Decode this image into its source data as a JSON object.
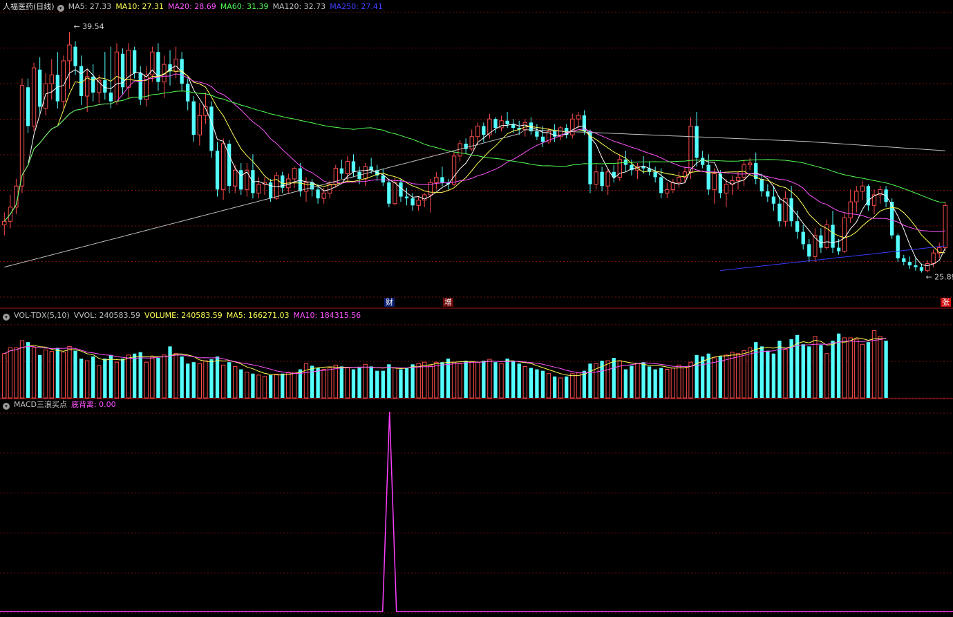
{
  "colors": {
    "up": "#ff4d4d",
    "down": "#54ffff",
    "ma5": "#ffffff",
    "ma10": "#ffff54",
    "ma20": "#ff54ff",
    "ma60": "#54ff54",
    "ma120": "#c0c0c0",
    "ma250": "#3a3aff",
    "grid": "#7a1010",
    "ma5_label": "#c0c0c0",
    "ma10_label": "#ffff54",
    "ma20_label": "#ff54ff",
    "ma60_label": "#54ff54",
    "ma120_label": "#c0c0c0",
    "ma250_label": "#4040ff",
    "macd_line": "#ff40ff"
  },
  "price_panel": {
    "title": "人福医药(日线)",
    "legend": [
      {
        "text": "MA5: 27.33",
        "color": "#c0c0c0"
      },
      {
        "text": "MA10: 27.31",
        "color": "#ffff54"
      },
      {
        "text": "MA20: 28.69",
        "color": "#ff54ff"
      },
      {
        "text": "MA60: 31.39",
        "color": "#54ff54"
      },
      {
        "text": "MA120: 32.73",
        "color": "#c0c0c0"
      },
      {
        "text": "MA250: 27.41",
        "color": "#4040ff"
      }
    ],
    "high_label": "39.54",
    "low_label": "25.89",
    "badges": [
      {
        "text": "财",
        "bg": "#0a1e6e",
        "fg": "#ffffff"
      },
      {
        "text": "增",
        "bg": "#6e0a0a",
        "fg": "#ffffff"
      },
      {
        "text": "张",
        "bg": "#d01010",
        "fg": "#ffffff"
      }
    ]
  },
  "vol_panel": {
    "label": "VOL-TDX(5,10)",
    "legend": [
      {
        "text": "VVOL: 240583.59",
        "color": "#c0c0c0"
      },
      {
        "text": "VOLUME: 240583.59",
        "color": "#ffff54"
      },
      {
        "text": "MA5: 166271.03",
        "color": "#ffff54"
      },
      {
        "text": "MA10: 184315.56",
        "color": "#ff54ff"
      }
    ]
  },
  "macd_panel": {
    "label": "MACD三浪买点",
    "legend": [
      {
        "text": "底背离: 0.00",
        "color": "#ff54ff"
      }
    ]
  },
  "chart_data": [
    {
      "type": "candlestick",
      "title": "人福医药(日线)",
      "ylim": [
        24.5,
        40.8
      ],
      "candles": [
        [
          28.6,
          29.3,
          28.0,
          28.8
        ],
        [
          28.8,
          30.3,
          28.4,
          29.6
        ],
        [
          29.6,
          31.2,
          29.2,
          30.8
        ],
        [
          30.8,
          36.9,
          30.4,
          36.5
        ],
        [
          36.4,
          36.9,
          33.8,
          34.2
        ],
        [
          34.2,
          37.8,
          33.9,
          37.5
        ],
        [
          37.4,
          38.1,
          34.9,
          35.3
        ],
        [
          35.2,
          37.2,
          34.8,
          36.6
        ],
        [
          36.6,
          38.0,
          35.7,
          37.1
        ],
        [
          37.1,
          38.4,
          35.2,
          35.6
        ],
        [
          35.6,
          38.2,
          35.2,
          37.9
        ],
        [
          37.9,
          39.54,
          36.3,
          38.8
        ],
        [
          38.7,
          39.0,
          37.1,
          37.6
        ],
        [
          37.6,
          38.2,
          35.4,
          35.9
        ],
        [
          35.9,
          37.4,
          35.0,
          37.0
        ],
        [
          37.0,
          37.7,
          35.6,
          36.1
        ],
        [
          36.1,
          37.1,
          35.5,
          36.8
        ],
        [
          36.8,
          38.4,
          35.7,
          36.1
        ],
        [
          36.1,
          38.7,
          35.2,
          35.6
        ],
        [
          35.6,
          38.9,
          35.4,
          38.4
        ],
        [
          38.3,
          38.6,
          36.0,
          36.4
        ],
        [
          36.4,
          38.9,
          35.8,
          38.5
        ],
        [
          38.5,
          38.7,
          36.9,
          37.2
        ],
        [
          37.2,
          37.6,
          35.4,
          35.7
        ],
        [
          35.7,
          37.6,
          35.3,
          37.1
        ],
        [
          37.1,
          38.7,
          36.7,
          38.4
        ],
        [
          38.4,
          38.9,
          36.2,
          36.7
        ],
        [
          36.7,
          38.2,
          35.8,
          37.7
        ],
        [
          37.7,
          38.5,
          36.5,
          37.3
        ],
        [
          37.3,
          38.7,
          36.9,
          38.0
        ],
        [
          38.0,
          38.4,
          36.2,
          36.6
        ],
        [
          36.6,
          36.9,
          35.1,
          35.6
        ],
        [
          35.6,
          35.9,
          33.3,
          33.7
        ],
        [
          33.7,
          35.5,
          33.1,
          34.8
        ],
        [
          34.8,
          36.1,
          34.3,
          35.3
        ],
        [
          35.3,
          35.6,
          32.4,
          32.8
        ],
        [
          32.8,
          33.3,
          30.2,
          30.6
        ],
        [
          30.6,
          33.5,
          30.0,
          33.2
        ],
        [
          33.2,
          33.4,
          30.4,
          30.8
        ],
        [
          30.8,
          32.0,
          30.4,
          31.7
        ],
        [
          31.7,
          32.1,
          30.3,
          30.6
        ],
        [
          30.6,
          32.1,
          30.2,
          31.7
        ],
        [
          31.7,
          32.6,
          30.1,
          30.4
        ],
        [
          30.4,
          31.3,
          30.1,
          30.9
        ],
        [
          30.9,
          31.3,
          30.3,
          31.0
        ],
        [
          31.0,
          31.2,
          29.9,
          30.1
        ],
        [
          30.1,
          31.6,
          30.0,
          31.4
        ],
        [
          31.4,
          31.6,
          30.4,
          30.7
        ],
        [
          30.7,
          31.5,
          30.4,
          31.2
        ],
        [
          31.2,
          31.9,
          30.7,
          31.8
        ],
        [
          31.8,
          32.1,
          30.2,
          30.5
        ],
        [
          30.5,
          31.3,
          29.9,
          31.0
        ],
        [
          31.0,
          31.2,
          30.2,
          30.6
        ],
        [
          30.6,
          30.9,
          29.8,
          30.1
        ],
        [
          30.1,
          30.7,
          29.8,
          30.4
        ],
        [
          30.4,
          31.1,
          30.1,
          30.9
        ],
        [
          30.9,
          32.0,
          30.7,
          31.8
        ],
        [
          31.8,
          32.3,
          31.2,
          31.5
        ],
        [
          31.5,
          32.5,
          31.0,
          32.2
        ],
        [
          32.2,
          32.6,
          31.3,
          31.6
        ],
        [
          31.6,
          31.9,
          30.9,
          31.2
        ],
        [
          31.2,
          32.1,
          30.8,
          31.9
        ],
        [
          31.9,
          32.4,
          31.5,
          31.7
        ],
        [
          31.7,
          32.0,
          31.1,
          31.4
        ],
        [
          31.4,
          31.8,
          30.8,
          31.0
        ],
        [
          31.0,
          31.2,
          29.6,
          29.8
        ],
        [
          29.8,
          31.3,
          29.7,
          31.0
        ],
        [
          31.0,
          31.2,
          29.9,
          30.2
        ],
        [
          30.2,
          30.7,
          29.7,
          30.1
        ],
        [
          30.1,
          30.4,
          29.4,
          29.7
        ],
        [
          29.7,
          30.2,
          29.4,
          30.0
        ],
        [
          30.0,
          30.4,
          29.6,
          30.3
        ],
        [
          30.3,
          31.2,
          29.3,
          31.0
        ],
        [
          31.0,
          31.6,
          30.6,
          31.3
        ],
        [
          31.3,
          31.9,
          30.8,
          31.0
        ],
        [
          31.0,
          31.2,
          30.6,
          30.9
        ],
        [
          30.9,
          32.7,
          30.8,
          32.5
        ],
        [
          32.5,
          33.4,
          32.2,
          33.2
        ],
        [
          33.2,
          33.5,
          32.6,
          32.9
        ],
        [
          32.9,
          34.0,
          32.8,
          33.6
        ],
        [
          33.6,
          34.4,
          33.1,
          34.2
        ],
        [
          34.2,
          34.4,
          33.3,
          33.7
        ],
        [
          33.7,
          34.9,
          33.5,
          34.6
        ],
        [
          34.6,
          34.7,
          33.8,
          34.1
        ],
        [
          34.1,
          34.8,
          33.9,
          34.5
        ],
        [
          34.5,
          35.0,
          34.1,
          34.3
        ],
        [
          34.3,
          34.6,
          33.8,
          34.1
        ],
        [
          34.1,
          34.5,
          33.7,
          34.0
        ],
        [
          34.0,
          34.6,
          33.6,
          34.4
        ],
        [
          34.4,
          34.7,
          33.7,
          33.9
        ],
        [
          33.9,
          34.3,
          33.4,
          33.6
        ],
        [
          33.6,
          34.2,
          33.0,
          33.3
        ],
        [
          33.3,
          34.1,
          33.2,
          33.9
        ],
        [
          33.9,
          34.3,
          33.3,
          33.6
        ],
        [
          33.6,
          34.2,
          33.4,
          34.1
        ],
        [
          34.1,
          34.3,
          33.5,
          33.7
        ],
        [
          33.7,
          34.9,
          33.5,
          34.6
        ],
        [
          34.6,
          35.0,
          34.1,
          34.8
        ],
        [
          34.8,
          35.1,
          33.7,
          33.9
        ],
        [
          33.9,
          34.0,
          30.4,
          30.9
        ],
        [
          30.9,
          32.0,
          30.6,
          31.6
        ],
        [
          31.6,
          31.9,
          30.5,
          30.8
        ],
        [
          30.8,
          31.8,
          30.3,
          31.6
        ],
        [
          31.6,
          32.0,
          31.0,
          31.3
        ],
        [
          31.3,
          32.6,
          31.1,
          32.3
        ],
        [
          32.3,
          32.8,
          31.6,
          32.0
        ],
        [
          32.0,
          32.3,
          31.4,
          31.7
        ],
        [
          31.7,
          32.1,
          31.2,
          31.9
        ],
        [
          31.9,
          32.5,
          31.5,
          31.8
        ],
        [
          31.8,
          32.2,
          31.4,
          31.6
        ],
        [
          31.6,
          31.9,
          31.0,
          31.3
        ],
        [
          31.3,
          31.8,
          30.1,
          30.4
        ],
        [
          30.4,
          31.0,
          30.1,
          30.6
        ],
        [
          30.6,
          31.2,
          30.4,
          31.0
        ],
        [
          31.0,
          31.6,
          30.7,
          31.3
        ],
        [
          31.3,
          31.9,
          31.0,
          31.6
        ],
        [
          31.6,
          34.7,
          31.2,
          34.2
        ],
        [
          34.2,
          35.0,
          31.9,
          32.4
        ],
        [
          32.4,
          32.8,
          31.8,
          32.0
        ],
        [
          32.0,
          32.6,
          30.3,
          30.6
        ],
        [
          30.6,
          31.8,
          29.8,
          31.5
        ],
        [
          31.5,
          31.7,
          30.1,
          30.4
        ],
        [
          30.4,
          31.2,
          29.6,
          30.9
        ],
        [
          30.9,
          31.4,
          30.3,
          31.1
        ],
        [
          31.1,
          31.6,
          30.6,
          31.3
        ],
        [
          31.3,
          32.3,
          30.8,
          32.0
        ],
        [
          32.0,
          32.4,
          31.7,
          32.1
        ],
        [
          32.1,
          32.7,
          30.9,
          31.2
        ],
        [
          31.2,
          31.5,
          30.2,
          30.5
        ],
        [
          30.5,
          30.9,
          29.9,
          30.2
        ],
        [
          30.2,
          30.8,
          29.4,
          29.8
        ],
        [
          29.8,
          30.2,
          28.5,
          28.8
        ],
        [
          28.8,
          30.5,
          28.5,
          30.1
        ],
        [
          30.1,
          30.8,
          28.5,
          28.8
        ],
        [
          28.8,
          29.4,
          27.8,
          28.2
        ],
        [
          28.2,
          28.6,
          27.2,
          27.5
        ],
        [
          27.5,
          27.8,
          26.5,
          26.8
        ],
        [
          26.8,
          28.4,
          26.5,
          28.0
        ],
        [
          28.0,
          28.4,
          27.0,
          27.3
        ],
        [
          27.3,
          28.9,
          27.2,
          28.6
        ],
        [
          28.6,
          29.4,
          27.0,
          27.3
        ],
        [
          27.3,
          27.8,
          26.9,
          27.1
        ],
        [
          27.1,
          29.3,
          27.0,
          29.0
        ],
        [
          29.0,
          30.6,
          28.7,
          29.9
        ],
        [
          29.9,
          30.8,
          29.3,
          30.5
        ],
        [
          30.5,
          31.1,
          30.0,
          30.8
        ],
        [
          30.8,
          30.9,
          29.4,
          29.7
        ],
        [
          29.7,
          30.6,
          29.2,
          30.3
        ],
        [
          30.3,
          30.8,
          29.8,
          30.6
        ],
        [
          30.6,
          30.8,
          29.6,
          29.9
        ],
        [
          29.9,
          30.1,
          27.8,
          28.0
        ],
        [
          28.0,
          28.1,
          26.5,
          26.7
        ],
        [
          26.7,
          26.9,
          26.3,
          26.5
        ],
        [
          26.5,
          26.8,
          26.1,
          26.3
        ],
        [
          26.3,
          26.7,
          26.0,
          26.2
        ],
        [
          26.2,
          26.4,
          25.89,
          26.0
        ],
        [
          26.0,
          26.6,
          25.9,
          26.4
        ],
        [
          26.4,
          27.2,
          26.2,
          27.0
        ],
        [
          27.0,
          27.6,
          26.7,
          27.3
        ],
        [
          27.3,
          29.9,
          27.1,
          29.7
        ]
      ]
    },
    {
      "type": "bar",
      "title": "VOL-TDX(5,10)",
      "ylim": [
        0,
        1.1
      ],
      "values": [
        0.62,
        0.7,
        0.7,
        0.8,
        0.78,
        0.7,
        0.6,
        0.67,
        0.65,
        0.7,
        0.64,
        0.72,
        0.66,
        0.55,
        0.52,
        0.58,
        0.45,
        0.55,
        0.6,
        0.5,
        0.55,
        0.6,
        0.62,
        0.64,
        0.5,
        0.57,
        0.56,
        0.6,
        0.72,
        0.62,
        0.58,
        0.48,
        0.5,
        0.48,
        0.52,
        0.54,
        0.58,
        0.46,
        0.5,
        0.44,
        0.4,
        0.36,
        0.34,
        0.32,
        0.3,
        0.32,
        0.33,
        0.34,
        0.36,
        0.36,
        0.4,
        0.48,
        0.45,
        0.42,
        0.4,
        0.42,
        0.46,
        0.44,
        0.42,
        0.4,
        0.42,
        0.47,
        0.44,
        0.38,
        0.38,
        0.47,
        0.42,
        0.4,
        0.42,
        0.47,
        0.48,
        0.5,
        0.45,
        0.5,
        0.5,
        0.55,
        0.5,
        0.48,
        0.52,
        0.5,
        0.5,
        0.52,
        0.54,
        0.5,
        0.48,
        0.55,
        0.52,
        0.48,
        0.44,
        0.42,
        0.4,
        0.38,
        0.34,
        0.3,
        0.28,
        0.3,
        0.34,
        0.35,
        0.38,
        0.48,
        0.48,
        0.52,
        0.52,
        0.56,
        0.52,
        0.4,
        0.45,
        0.48,
        0.5,
        0.44,
        0.4,
        0.42,
        0.4,
        0.42,
        0.46,
        0.42,
        0.5,
        0.6,
        0.58,
        0.62,
        0.56,
        0.58,
        0.6,
        0.64,
        0.62,
        0.66,
        0.7,
        0.78,
        0.72,
        0.66,
        0.62,
        0.8,
        0.68,
        0.82,
        0.88,
        0.75,
        0.72,
        0.86,
        0.74,
        0.62,
        0.8,
        0.9,
        0.84,
        0.84,
        0.82,
        0.75,
        0.78,
        0.94,
        0.86,
        0.8
      ],
      "up": [
        1,
        1,
        1,
        1,
        0,
        1,
        0,
        1,
        1,
        0,
        1,
        1,
        0,
        0,
        1,
        0,
        1,
        0,
        0,
        1,
        0,
        1,
        0,
        0,
        1,
        1,
        0,
        1,
        0,
        1,
        0,
        0,
        0,
        1,
        1,
        0,
        0,
        1,
        0,
        1,
        0,
        1,
        0,
        1,
        1,
        0,
        1,
        0,
        1,
        1,
        0,
        1,
        0,
        0,
        1,
        1,
        1,
        0,
        1,
        0,
        0,
        1,
        0,
        0,
        0,
        0,
        1,
        0,
        0,
        0,
        1,
        1,
        1,
        1,
        0,
        0,
        1,
        1,
        0,
        1,
        1,
        0,
        1,
        0,
        1,
        0,
        0,
        0,
        1,
        0,
        0,
        0,
        1,
        0,
        1,
        0,
        1,
        1,
        0,
        0,
        1,
        0,
        1,
        0,
        1,
        0,
        0,
        1,
        0,
        0,
        0,
        0,
        1,
        1,
        1,
        1,
        1,
        0,
        0,
        0,
        1,
        0,
        1,
        1,
        1,
        1,
        1,
        0,
        0,
        0,
        0,
        0,
        1,
        0,
        0,
        0,
        0,
        1,
        0,
        1,
        0,
        0,
        1,
        1,
        1,
        1,
        0,
        1,
        1,
        0,
        0,
        0,
        0,
        0,
        0,
        0,
        1,
        1,
        1,
        1
      ]
    },
    {
      "type": "line",
      "title": "MACD三浪买点",
      "series": [
        {
          "name": "底背离",
          "values": [
            0,
            1,
            0
          ]
        }
      ],
      "spike_at": 0.41,
      "ylim": [
        0,
        1
      ]
    }
  ]
}
